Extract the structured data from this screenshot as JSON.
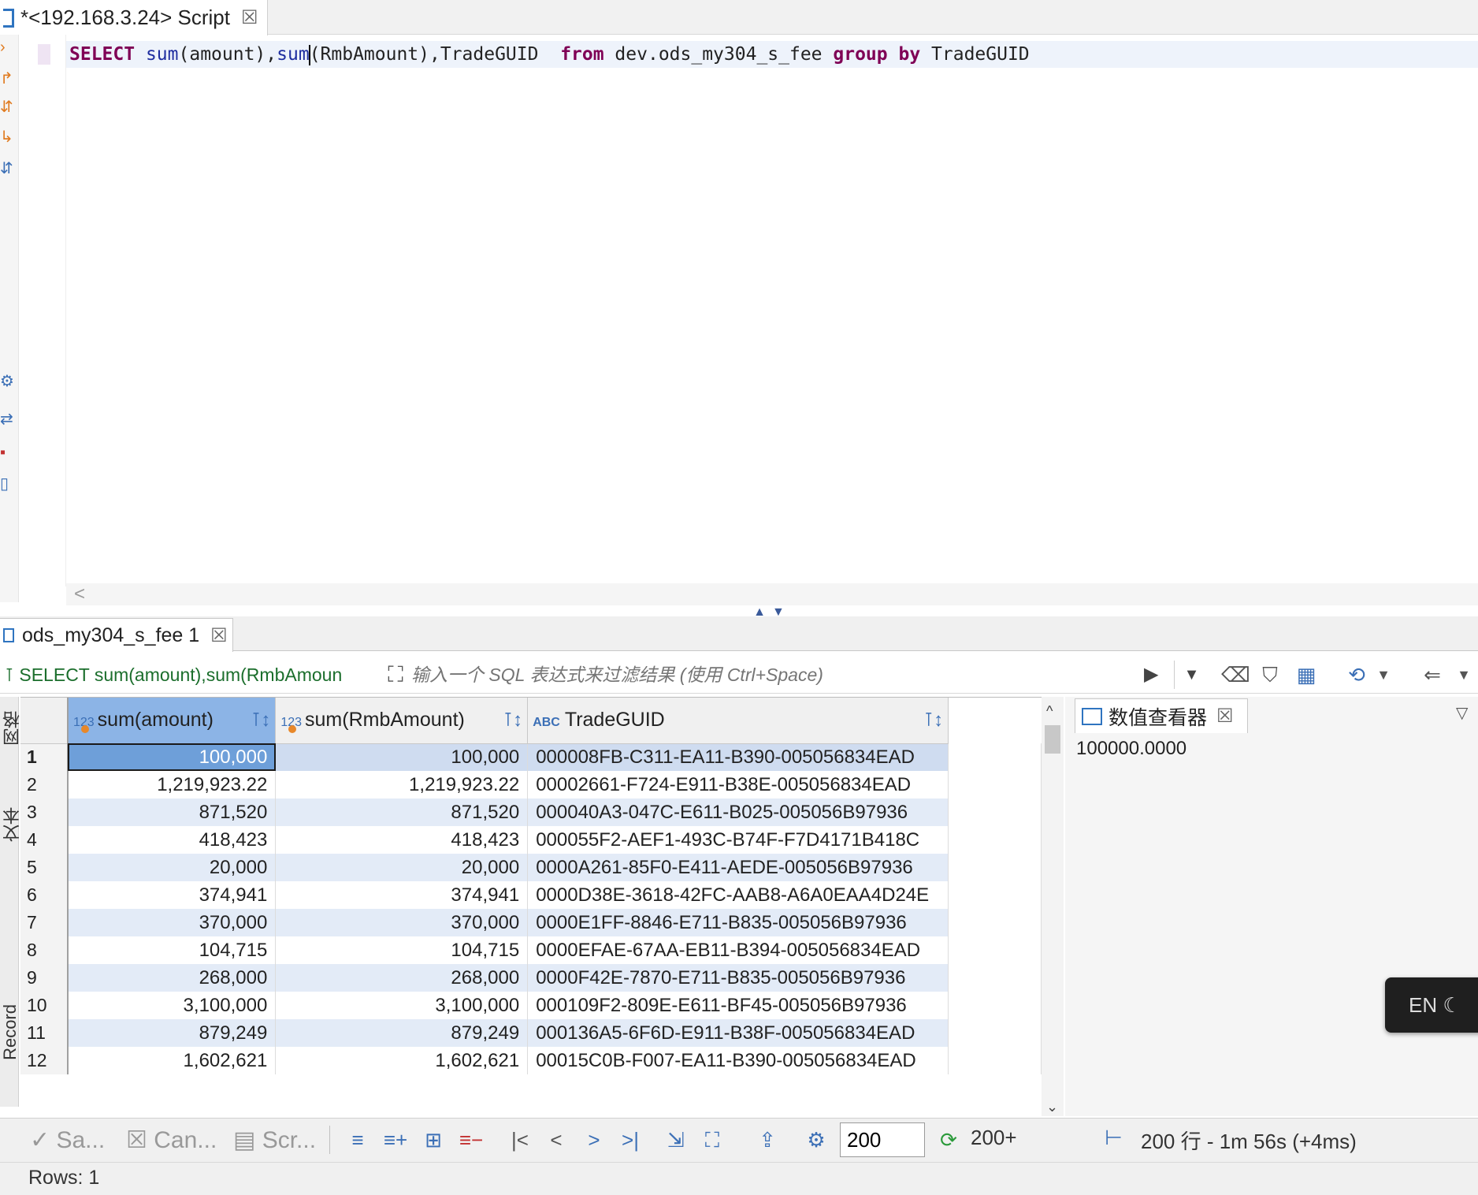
{
  "editor": {
    "tab_title": "*<192.168.3.24> Script",
    "tab_close": "☒",
    "sql": {
      "select": "SELECT",
      "sum1": "sum",
      "arg1": "(amount),",
      "sum2_a": "su",
      "sum2_b": "m",
      "arg2": "(RmbAmount),TradeGUID  ",
      "from": "from",
      "table": " dev.ods_my304_s_fee ",
      "group": "group",
      "by": "by",
      "groupcol": " TradeGUID"
    },
    "hscroll_left": "<"
  },
  "results": {
    "tab_title": "ods_my304_s_fee 1",
    "tab_close": "☒",
    "filter_query": "SELECT sum(amount),sum(RmbAmoun",
    "filter_placeholder": "输入一个 SQL 表达式来过滤结果 (使用 Ctrl+Space)",
    "columns": [
      {
        "type": "123",
        "name": "sum(amount)"
      },
      {
        "type": "123",
        "name": "sum(RmbAmount)"
      },
      {
        "type": "ABC",
        "name": "TradeGUID"
      }
    ],
    "rows": [
      {
        "n": "1",
        "a": "100,000",
        "b": "100,000",
        "g": "000008FB-C311-EA11-B390-005056834EAD"
      },
      {
        "n": "2",
        "a": "1,219,923.22",
        "b": "1,219,923.22",
        "g": "00002661-F724-E911-B38E-005056834EAD"
      },
      {
        "n": "3",
        "a": "871,520",
        "b": "871,520",
        "g": "000040A3-047C-E611-B025-005056B97936"
      },
      {
        "n": "4",
        "a": "418,423",
        "b": "418,423",
        "g": "000055F2-AEF1-493C-B74F-F7D4171B418C"
      },
      {
        "n": "5",
        "a": "20,000",
        "b": "20,000",
        "g": "0000A261-85F0-E411-AEDE-005056B97936"
      },
      {
        "n": "6",
        "a": "374,941",
        "b": "374,941",
        "g": "0000D38E-3618-42FC-AAB8-A6A0EAA4D24E"
      },
      {
        "n": "7",
        "a": "370,000",
        "b": "370,000",
        "g": "0000E1FF-8846-E711-B835-005056B97936"
      },
      {
        "n": "8",
        "a": "104,715",
        "b": "104,715",
        "g": "0000EFAE-67AA-EB11-B394-005056834EAD"
      },
      {
        "n": "9",
        "a": "268,000",
        "b": "268,000",
        "g": "0000F42E-7870-E711-B835-005056B97936"
      },
      {
        "n": "10",
        "a": "3,100,000",
        "b": "3,100,000",
        "g": "000109F2-809E-E611-BF45-005056B97936"
      },
      {
        "n": "11",
        "a": "879,249",
        "b": "879,249",
        "g": "000136A5-6F6D-E911-B38F-005056834EAD"
      },
      {
        "n": "12",
        "a": "1,602,621",
        "b": "1,602,621",
        "g": "00015C0B-F007-EA11-B390-005056834EAD"
      }
    ],
    "side_labels": {
      "grid": "网格",
      "text": "文本",
      "record": "Record"
    }
  },
  "viewer": {
    "tab_title": "数值查看器",
    "tab_close": "☒",
    "value": "100000.0000"
  },
  "ime": {
    "label": "EN"
  },
  "bottom": {
    "save": "Sa...",
    "cancel": "Can...",
    "script": "Scr...",
    "fetch_size": "200",
    "rows_fetched": "200+",
    "status": "200 行 - 1m 56s (+4ms)"
  },
  "status_bar": {
    "rows": "Rows: 1"
  },
  "colors": {
    "keyword": "#7f0055",
    "function": "#1f2ea0",
    "accent": "#3b6fb6",
    "selected_header": "#8cb4e6",
    "current_cell": "#6e9fd9"
  }
}
